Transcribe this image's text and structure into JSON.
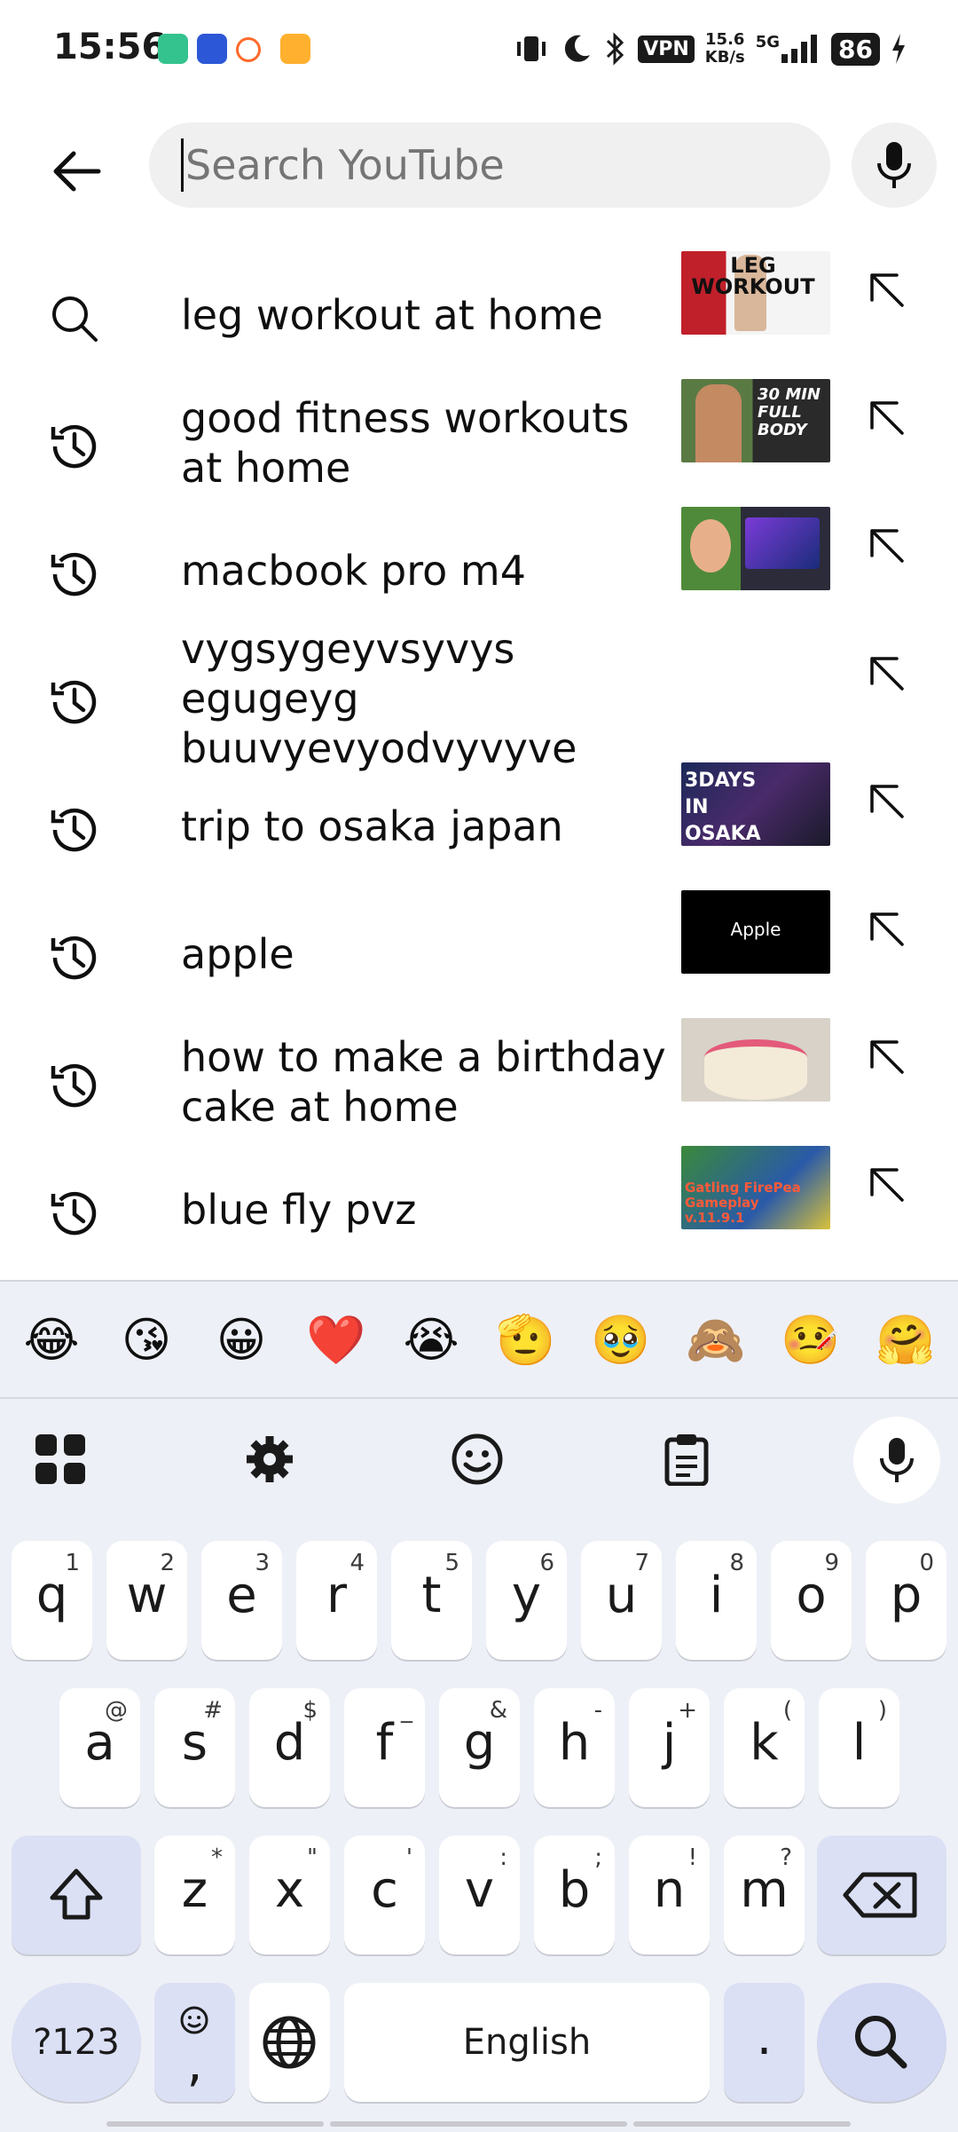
{
  "status_bar": {
    "time": "15:56",
    "vpn": "VPN",
    "speed_value": "15.6",
    "speed_unit": "KB/s",
    "network": "5G",
    "battery": "86"
  },
  "search": {
    "placeholder": "Search YouTube",
    "value": ""
  },
  "suggestions": [
    {
      "text": "leg workout at home",
      "type": "search",
      "thumb": "LEG WORKOUT"
    },
    {
      "text": "good fitness workouts at home",
      "type": "history",
      "thumb": "30 MIN FULL BODY"
    },
    {
      "text": "macbook pro m4",
      "type": "history",
      "thumb": ""
    },
    {
      "text": "vygsygeyvsyvys egugeyg buuvyevyodvyvyve",
      "type": "history",
      "thumb": ""
    },
    {
      "text": "trip to osaka japan",
      "type": "history",
      "thumb": "3DAYS IN OSAKA"
    },
    {
      "text": "apple",
      "type": "history",
      "thumb": "Apple"
    },
    {
      "text": "how to make a birthday cake at home",
      "type": "history",
      "thumb": ""
    },
    {
      "text": "blue fly pvz",
      "type": "history",
      "thumb": "Gatling FirePea Gameplay v.11.9.1"
    }
  ],
  "keyboard": {
    "emojis": [
      "😂",
      "😘",
      "😀",
      "❤️",
      "😭",
      "🫡",
      "🥹",
      "🙈",
      "🤒",
      "🤗"
    ],
    "row1": [
      [
        "q",
        "1"
      ],
      [
        "w",
        "2"
      ],
      [
        "e",
        "3"
      ],
      [
        "r",
        "4"
      ],
      [
        "t",
        "5"
      ],
      [
        "y",
        "6"
      ],
      [
        "u",
        "7"
      ],
      [
        "i",
        "8"
      ],
      [
        "o",
        "9"
      ],
      [
        "p",
        "0"
      ]
    ],
    "row2": [
      [
        "a",
        "@"
      ],
      [
        "s",
        "#"
      ],
      [
        "d",
        "$"
      ],
      [
        "f",
        "_"
      ],
      [
        "g",
        "&"
      ],
      [
        "h",
        "-"
      ],
      [
        "j",
        "+"
      ],
      [
        "k",
        "("
      ],
      [
        "l",
        ")"
      ]
    ],
    "row3": [
      [
        "z",
        "*"
      ],
      [
        "x",
        "\""
      ],
      [
        "c",
        "'"
      ],
      [
        "v",
        ":"
      ],
      [
        "b",
        ";"
      ],
      [
        "n",
        "!"
      ],
      [
        "m",
        "?"
      ]
    ],
    "symbols_label": "?123",
    "comma": ",",
    "space_label": "English",
    "period": "."
  },
  "colors": {
    "accent_key": "#dbe0f5",
    "keyboard_bg": "#eef0f7",
    "search_bg": "#f0f0f0"
  }
}
